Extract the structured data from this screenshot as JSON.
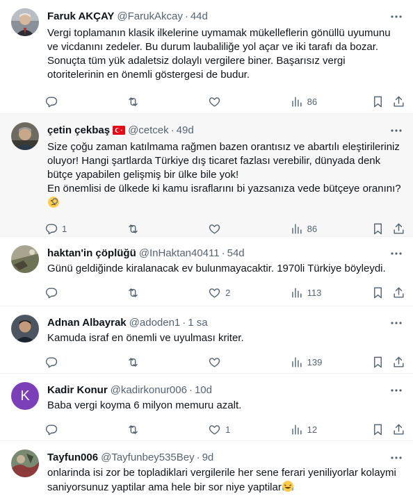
{
  "tweets": [
    {
      "name": "Faruk AKÇAY",
      "handle": "@FarukAkcay",
      "time": "44d",
      "text": "Vergi toplamanın klasik ilkelerine uymamak mükelleflerin gönüllü uyumunu\nve vicdanını zedeler. Bu durum laubaliliğe yol açar ve iki tarafı da bozar.\nSonuçta tüm yük adaletsiz dolaylı vergilere biner. Başarısız vergi\notoritelerinin en önemli göstergesi de budur.",
      "replies": "",
      "reposts": "",
      "likes": "",
      "views": "86"
    },
    {
      "name": "çetin çekbaş",
      "handle": "@cetcek",
      "time": "49d",
      "text": "Size çoğu zaman katılmama rağmen bazen orantısız ve abartılı eleştirileriniz\noluyor! Hangi şartlarda Türkiye dış ticaret fazlası verebilir, dünyada denk\nbütçe yapabilen gelişmiş bir ülke bile yok!\nEn önemlisi de ülkede ki kamu israflarını bi yazsanıza vede bütçeye oranını?",
      "replies": "1",
      "reposts": "",
      "likes": "",
      "views": "86"
    },
    {
      "name": "haktan'in çöplüğü",
      "handle": "@InHaktan40411",
      "time": "54d",
      "text": "Günü geldiğinde kiralanacak ev bulunmayacaktir. 1970li Türkiye böyleydi.",
      "replies": "",
      "reposts": "",
      "likes": "2",
      "views": "113"
    },
    {
      "name": "Adnan Albayrak",
      "handle": "@adoden1",
      "time": "1 sa",
      "text": "Kamuda israf en önemli ve uyulması kriter.",
      "replies": "",
      "reposts": "",
      "likes": "",
      "views": "139"
    },
    {
      "name": "Kadir Konur",
      "handle": "@kadirkonur006",
      "time": "10d",
      "text": "Baba vergi koyma 6 milyon memuru azalt.",
      "replies": "",
      "reposts": "",
      "likes": "1",
      "views": "12"
    },
    {
      "name": "Tayfun006",
      "handle": "@Tayfunbey535Bey",
      "time": "9d",
      "text": "onlarinda isi zor be topladiklari vergilerile her sene ferari yeniliyorlar kolaymi\nsaniyorsunuz yaptilar ama hele bir sor niye yaptilar",
      "replies": "",
      "reposts": "",
      "likes": "",
      "views": ""
    }
  ],
  "avatar_letter": "K",
  "colors": {
    "muted": "#536471",
    "text": "#0f1419",
    "avatar_k": "#7b3fb8",
    "flag": "#e30a17"
  },
  "icons": [
    "more-icon",
    "reply-icon",
    "repost-icon",
    "like-icon",
    "views-icon",
    "bookmark-icon",
    "share-icon",
    "turkey-flag-icon",
    "emoji-icon"
  ]
}
